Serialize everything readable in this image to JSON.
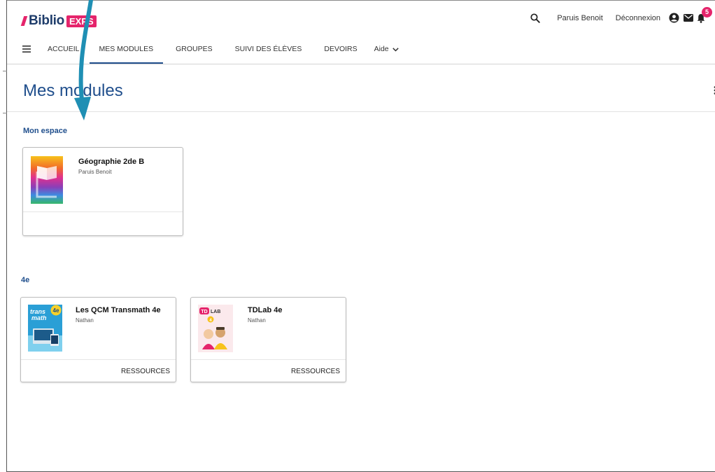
{
  "brand": {
    "name": "Biblio",
    "tag": "EXPS"
  },
  "header": {
    "user_name": "Paruis Benoit",
    "logout_label": "Déconnexion",
    "notification_count": "5",
    "accent_color": "#e5246b"
  },
  "nav": {
    "items": [
      {
        "label": "ACCUEIL"
      },
      {
        "label": "MES MODULES"
      },
      {
        "label": "GROUPES"
      },
      {
        "label": "SUIVI DES ÉLÈVES"
      },
      {
        "label": "DEVOIRS"
      },
      {
        "label": "Aide"
      }
    ],
    "active_index": 1
  },
  "page": {
    "title": "Mes modules",
    "sections": [
      {
        "label": "Mon espace",
        "cards": [
          {
            "title": "Géographie 2de B",
            "subtitle": "Paruis Benoit",
            "action": ""
          }
        ]
      },
      {
        "label": "4e",
        "cards": [
          {
            "title": "Les QCM Transmath 4e",
            "subtitle": "Nathan",
            "action": "RESSOURCES"
          },
          {
            "title": "TDLab 4e",
            "subtitle": "Nathan",
            "action": "RESSOURCES"
          }
        ]
      }
    ]
  },
  "cover_texts": {
    "transmath_word1": "trans",
    "transmath_word2": "math",
    "transmath_grade": "4e",
    "tdlab_td": "TD",
    "tdlab_lab": "LAB",
    "tdlab_grade": "4"
  },
  "icons": {
    "menu": "hamburger-icon",
    "search": "search-icon",
    "account": "account-circle-icon",
    "mail": "mail-icon",
    "bell": "bell-icon",
    "chevron": "chevron-down-icon",
    "more": "more-vertical-icon"
  }
}
